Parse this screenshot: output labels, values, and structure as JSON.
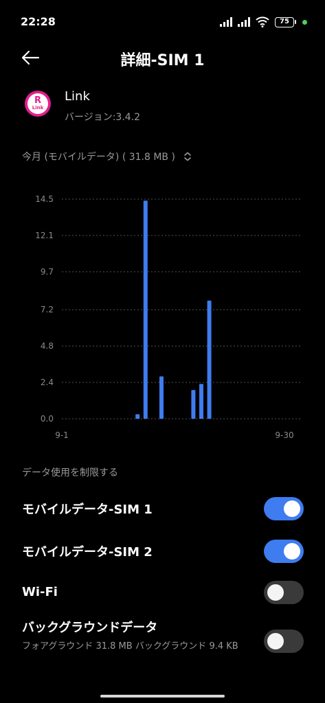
{
  "status": {
    "time": "22:28",
    "battery": "75"
  },
  "header": {
    "title": "詳細-SIM 1"
  },
  "app": {
    "name": "Link",
    "version": "バージョン:3.4.2",
    "icon_text": "R",
    "icon_sub": "Link",
    "brand_color": "#e31e8d"
  },
  "period": {
    "label": "今月 (モバイルデータ) ( 31.8 MB )"
  },
  "chart_data": {
    "type": "bar",
    "x_start_label": "9-1",
    "x_end_label": "9-30",
    "y_ticks": [
      "14.5",
      "12.1",
      "9.7",
      "7.2",
      "4.8",
      "2.4",
      "0.0"
    ],
    "ylim": [
      0,
      14.5
    ],
    "days": [
      1,
      2,
      3,
      4,
      5,
      6,
      7,
      8,
      9,
      10,
      11,
      12,
      13,
      14,
      15,
      16,
      17,
      18,
      19,
      20,
      21,
      22,
      23,
      24,
      25,
      26,
      27,
      28,
      29,
      30
    ],
    "values": [
      0,
      0,
      0,
      0,
      0,
      0,
      0,
      0,
      0,
      0.3,
      14.4,
      0,
      2.8,
      0,
      0,
      0,
      1.9,
      2.3,
      7.8,
      0,
      0,
      0,
      0,
      0,
      0,
      0,
      0,
      0,
      0,
      0
    ],
    "bar_color": "#3e7cf0",
    "grid": true
  },
  "limits": {
    "header": "データ使用を制限する",
    "items": [
      {
        "label": "モバイルデータ-SIM 1",
        "on": true
      },
      {
        "label": "モバイルデータ-SIM 2",
        "on": true
      },
      {
        "label": "Wi-Fi",
        "on": false
      },
      {
        "label": "バックグラウンドデータ",
        "sub": "フォアグラウンド 31.8 MB  バックグラウンド 9.4 KB",
        "on": false
      }
    ]
  }
}
